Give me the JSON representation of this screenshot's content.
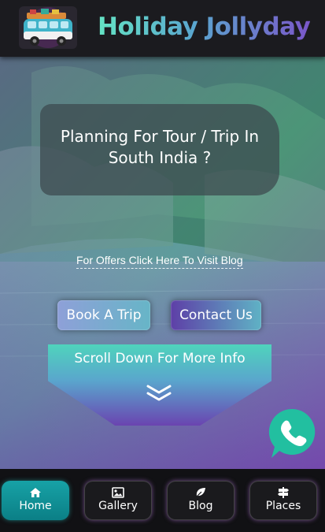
{
  "header": {
    "brand_title": "Holiday Jollyday"
  },
  "hero": {
    "headline": "Planning For Tour / Trip In South India ?",
    "offer_link": "For Offers Click Here To Visit Blog",
    "book_button": "Book A Trip",
    "contact_button": "Contact Us",
    "scroll_text": "Scroll Down For More Info",
    "scroll_icon": "double-chevron-down-icon",
    "whatsapp_icon": "whatsapp-phone-icon"
  },
  "bottom_nav": {
    "items": [
      {
        "label": "Home",
        "icon": "home-icon",
        "active": true
      },
      {
        "label": "Gallery",
        "icon": "image-icon",
        "active": false
      },
      {
        "label": "Blog",
        "icon": "leaf-icon",
        "active": false
      },
      {
        "label": "Places",
        "icon": "signpost-icon",
        "active": false
      }
    ]
  },
  "colors": {
    "header_bg": "#1b1b1f",
    "nav_active": "#139499",
    "whatsapp": "#22bfa0"
  }
}
